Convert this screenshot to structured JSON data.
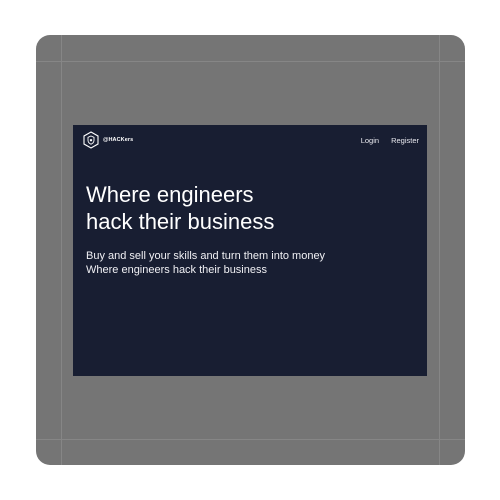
{
  "brand": {
    "name": "@HACKers",
    "icon": "shield-hexagon-icon"
  },
  "nav": {
    "login_label": "Login",
    "register_label": "Register"
  },
  "hero": {
    "title_line1": "Where engineers",
    "title_line2": "hack their business",
    "subtitle_line1": "Buy and sell your skills and turn them into money",
    "subtitle_line2": "Where engineers hack their business"
  },
  "colors": {
    "frame_background": "#757575",
    "screen_background": "#181e32",
    "text": "#ffffff"
  }
}
